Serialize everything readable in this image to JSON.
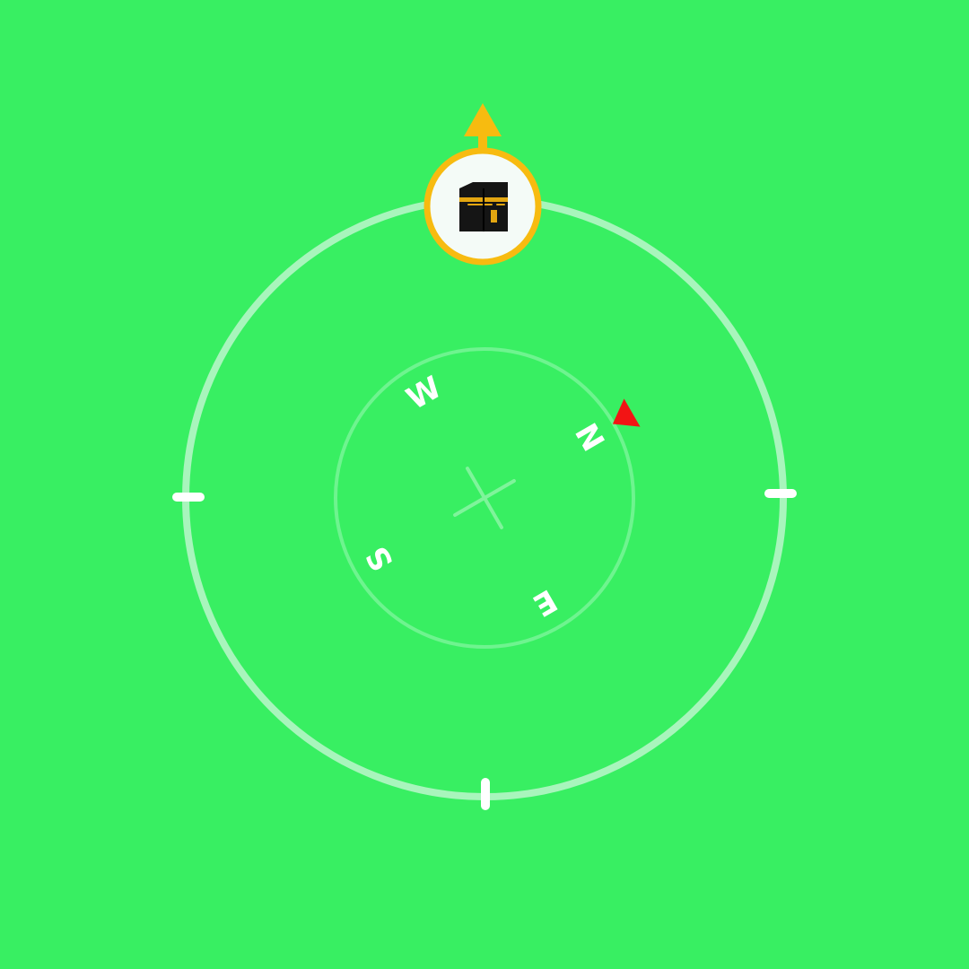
{
  "colors": {
    "background": "#38ef62",
    "outer_ring": "#a8f5bc",
    "inner_ring": "#6ef48f",
    "crosshair": "#7ff49b",
    "ticks": "#ffffff",
    "labels": "#ffffff",
    "qibla_badge_border": "#f7bb10",
    "qibla_badge_fill": "#f4fbf7",
    "qibla_arrow": "#f7bb10",
    "north_marker": "#f21414",
    "kaaba_body": "#151515",
    "kaaba_band": "#e3a611"
  },
  "compass": {
    "rotation_deg": 60,
    "cardinals": {
      "north": "N",
      "east": "E",
      "south": "S",
      "west": "W"
    }
  },
  "icons": {
    "qibla_badge": "kaaba-icon",
    "qibla_arrow": "arrow-up-icon",
    "north_marker": "triangle-pointer-icon",
    "center": "crosshair-icon"
  }
}
